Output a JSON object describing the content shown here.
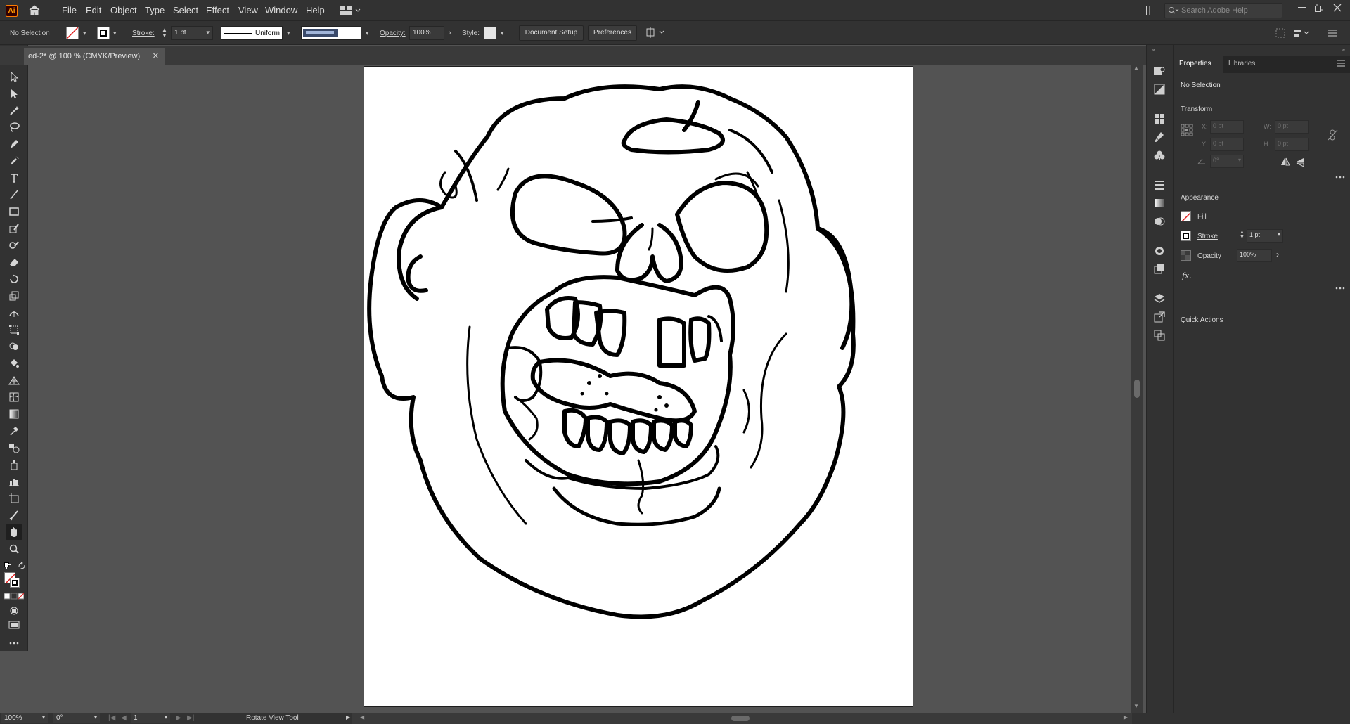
{
  "app": {
    "logo": "Ai"
  },
  "menu": [
    "File",
    "Edit",
    "Object",
    "Type",
    "Select",
    "Effect",
    "View",
    "Window",
    "Help"
  ],
  "search": {
    "placeholder": "Search Adobe Help"
  },
  "control": {
    "selection": "No Selection",
    "stroke_label": "Stroke:",
    "stroke_value": "1 pt",
    "profile": "Uniform",
    "opacity_label": "Opacity:",
    "opacity_value": "100%",
    "style_label": "Style:",
    "document_setup": "Document Setup",
    "preferences": "Preferences"
  },
  "document": {
    "tab_title": "ed-2* @ 100 % (CMYK/Preview)"
  },
  "panel": {
    "tabs": [
      "Properties",
      "Libraries"
    ],
    "no_selection": "No Selection",
    "transform_title": "Transform",
    "x_label": "X:",
    "x_value": "0 pt",
    "y_label": "Y:",
    "y_value": "0 pt",
    "w_label": "W:",
    "w_value": "0 pt",
    "h_label": "H:",
    "h_value": "0 pt",
    "angle_value": "0°",
    "appearance_title": "Appearance",
    "fill_label": "Fill",
    "stroke_label": "Stroke",
    "stroke_value": "1 pt",
    "opacity_label": "Opacity",
    "opacity_value": "100%",
    "fx_label": "fx.",
    "quick_actions": "Quick Actions"
  },
  "status": {
    "zoom": "100%",
    "rotation": "0°",
    "artboard": "1",
    "tool": "Rotate View Tool"
  },
  "colors": {
    "accent_logo": "#ff9a00",
    "ui_dark": "#323232",
    "canvas": "#535353"
  }
}
